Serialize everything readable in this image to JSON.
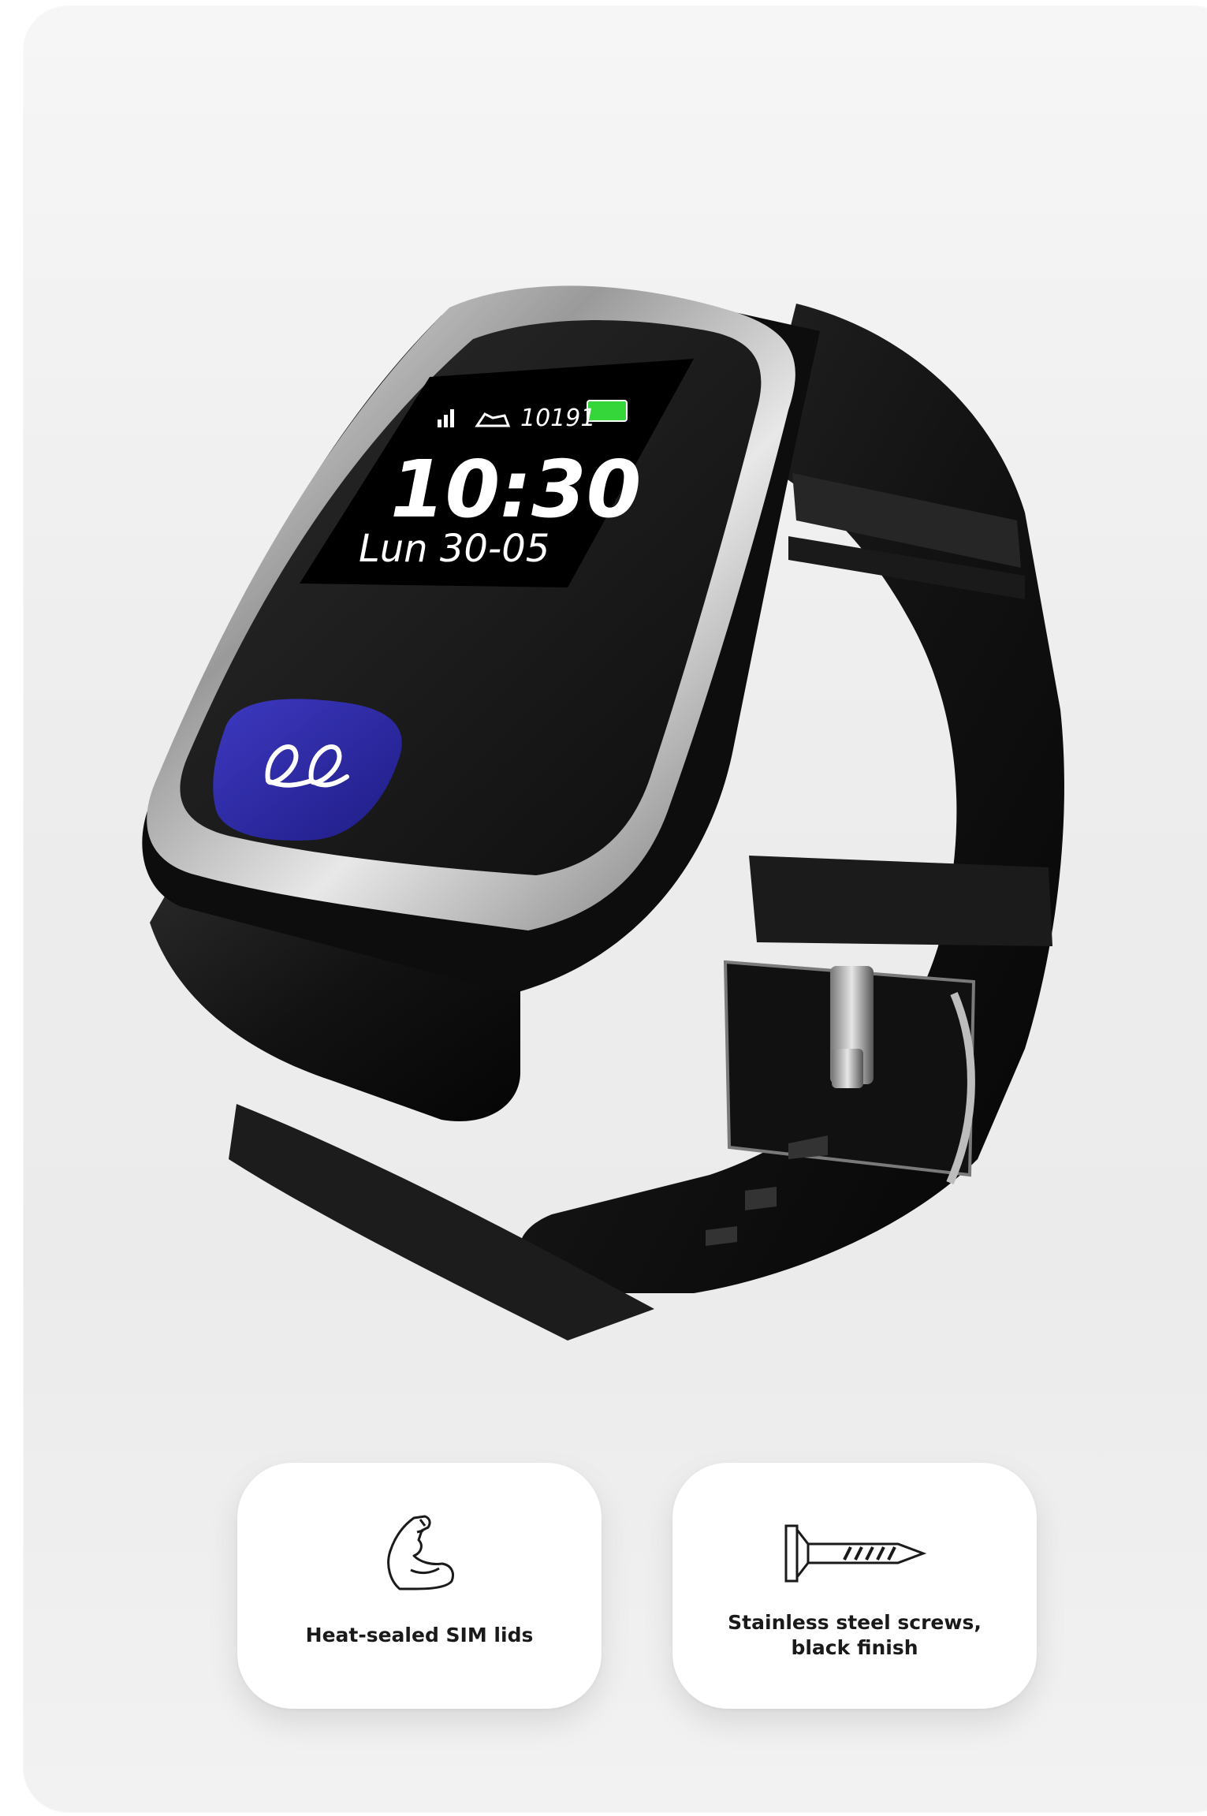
{
  "watch_screen": {
    "steps": "10191",
    "time": "10:30",
    "date": "Lun 30-05"
  },
  "features": [
    {
      "label": "Heat-sealed SIM lids",
      "icon": "flexed-arm-icon"
    },
    {
      "label": "Stainless steel screws, black finish",
      "icon": "screw-icon"
    }
  ],
  "colors": {
    "button_accent": "#2e2aa6",
    "battery_green": "#35d63a"
  }
}
